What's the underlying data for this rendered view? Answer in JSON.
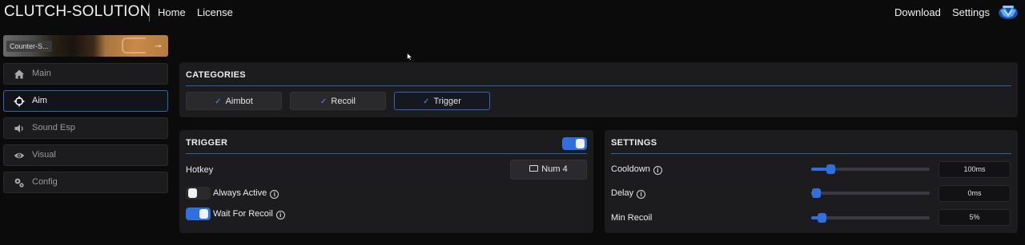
{
  "brand": "CLUTCH-SOLUTION",
  "nav": {
    "home": "Home",
    "license": "License",
    "download": "Download",
    "settings": "Settings"
  },
  "banner": {
    "tag": "Counter-S...",
    "arrow_icon": "arrow-right-icon"
  },
  "sidebar": {
    "items": [
      {
        "label": "Main",
        "icon": "home-icon",
        "active": false
      },
      {
        "label": "Aim",
        "icon": "crosshair-icon",
        "active": true
      },
      {
        "label": "Sound Esp",
        "icon": "speaker-icon",
        "active": false
      },
      {
        "label": "Visual",
        "icon": "eye-icon",
        "active": false
      },
      {
        "label": "Config",
        "icon": "gears-icon",
        "active": false
      }
    ]
  },
  "categories": {
    "title": "CATEGORIES",
    "buttons": [
      {
        "label": "Aimbot",
        "active": false
      },
      {
        "label": "Recoil",
        "active": false
      },
      {
        "label": "Trigger",
        "active": true
      }
    ]
  },
  "trigger": {
    "title": "TRIGGER",
    "enabled": true,
    "hotkey_label": "Hotkey",
    "hotkey_value": "Num 4",
    "always_active": {
      "label": "Always Active",
      "on": false
    },
    "wait_for_recoil": {
      "label": "Wait For Recoil",
      "on": true
    }
  },
  "settings": {
    "title": "SETTINGS",
    "rows": [
      {
        "label": "Cooldown",
        "info": true,
        "value": "100ms",
        "level": 0.13
      },
      {
        "label": "Delay",
        "info": true,
        "value": "0ms",
        "level": 0.0
      },
      {
        "label": "Min Recoil",
        "info": false,
        "value": "5%",
        "level": 0.05
      }
    ]
  },
  "colors": {
    "accent": "#2f6fe0",
    "panel": "#1c1c1e",
    "background": "#0b0b0c"
  }
}
